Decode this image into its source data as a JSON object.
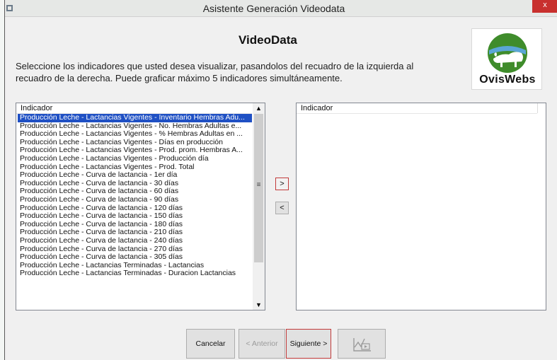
{
  "window": {
    "title": "Asistente Generación Videodata",
    "close_label": "x"
  },
  "header": {
    "title": "VideoData",
    "instructions_line1": "Seleccione los indicadores que usted desea visualizar, pasandolos del recuadro de la izquierda al",
    "instructions_line2": "recuadro de la derecha. Puede graficar máximo 5 indicadores simultáneamente."
  },
  "logo": {
    "text": "OvisWebs",
    "colors": {
      "green": "#3f8c2b",
      "sky": "#5aa6d6"
    }
  },
  "left_list": {
    "column_header": "Indicador",
    "selected_index": 0,
    "items": [
      "Producción Leche - Lactancias Vigentes - Inventario Hembras Adu...",
      "Producción Leche - Lactancias Vigentes - No. Hembras Adultas e...",
      "Producción Leche - Lactancias Vigentes - % Hembras Adultas en ...",
      "Producción Leche - Lactancias Vigentes - Días en producción",
      "Producción Leche - Lactancias Vigentes - Prod. prom. Hembras A...",
      "Producción Leche - Lactancias Vigentes - Producción día",
      "Producción Leche - Lactancias Vigentes - Prod. Total",
      "Producción Leche - Curva de lactancia - 1er día",
      "Producción Leche - Curva de lactancia - 30 días",
      "Producción Leche - Curva de lactancia - 60 días",
      "Producción Leche - Curva de lactancia - 90 días",
      "Producción Leche - Curva de lactancia - 120 días",
      "Producción Leche - Curva de lactancia - 150 días",
      "Producción Leche - Curva de lactancia - 180 días",
      "Producción Leche - Curva de lactancia - 210 días",
      "Producción Leche - Curva de lactancia - 240 días",
      "Producción Leche - Curva de lactancia - 270 días",
      "Producción Leche - Curva de lactancia - 305 días",
      "Producción Leche - Lactancias Terminadas - Lactancias",
      "Producción Leche - Lactancias Terminadas - Duracion Lactancias"
    ],
    "scroll_up": "▲",
    "scroll_down": "▼",
    "scroll_grip": "≡"
  },
  "right_list": {
    "column_header": "Indicador",
    "items": []
  },
  "move_buttons": {
    "add": ">",
    "remove": "<"
  },
  "footer": {
    "cancel": "Cancelar",
    "previous": "< Anterior",
    "next": "Siguiente >",
    "chart_icon": "chart-play-icon"
  },
  "colors": {
    "selection": "#1f50c4",
    "focus_border": "#c23a3a",
    "close": "#c8302e"
  }
}
